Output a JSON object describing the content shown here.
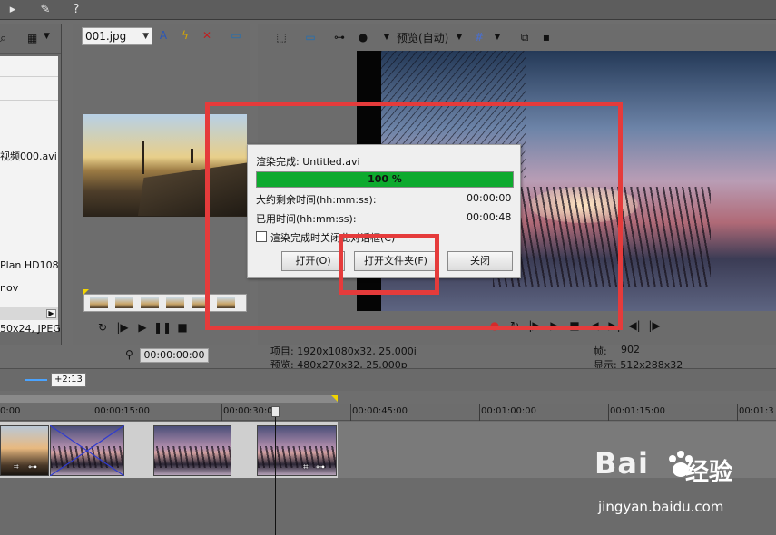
{
  "explorer": {
    "items": [
      "视频000.avi",
      "Plan HD108",
      "nov"
    ],
    "status": "50x24, JPEG"
  },
  "trimmer": {
    "file_dropdown": "001.jpg",
    "timecode": "00:00:00:00"
  },
  "preview": {
    "mode_label": "预览(自动)",
    "project_label": "项目: 1920x1080x32, 25.000i",
    "preview_label": "预览: 480x270x32, 25.000p",
    "frame_label": "帧:",
    "frame_value": "902",
    "display_label": "显示: 512x288x32"
  },
  "dialog": {
    "status": "渲染完成: Untitled.avi",
    "progress_percent": 100,
    "progress_text": "100 %",
    "remaining_label": "大约剩余时间(hh:mm:ss):",
    "remaining_value": "00:00:00",
    "elapsed_label": "已用时间(hh:mm:ss):",
    "elapsed_value": "00:00:48",
    "checkbox_label": "渲染完成时关闭此对话框(C)",
    "open_button": "打开(O)",
    "open_folder_button": "打开文件夹(F)",
    "close_button": "关闭"
  },
  "timeline": {
    "badge": "+2:13",
    "ticks": [
      "0:00",
      "00:00:15:00",
      "00:00:30:00",
      "00:00:45:00",
      "00:01:00:00",
      "00:01:15:00",
      "00:01:3"
    ]
  },
  "watermark": {
    "logo": "Bai",
    "logo_cn": "经验",
    "url": "jingyan.baidu.com"
  },
  "colors": {
    "annotation_red": "#e53b3b",
    "progress_green": "#0daa2e"
  },
  "icons": [
    "brush-icon",
    "cursor-help-icon",
    "search-icon",
    "view-grid-icon",
    "pin-icon",
    "text-icon",
    "lightning-icon",
    "close-icon",
    "monitor-icon",
    "select-icon",
    "monitor-icon",
    "split-icon",
    "circle-icon",
    "grid-icon",
    "copy-icon",
    "save-icon",
    "loop-icon",
    "play-icon",
    "pause-icon",
    "stop-icon",
    "record-icon"
  ]
}
